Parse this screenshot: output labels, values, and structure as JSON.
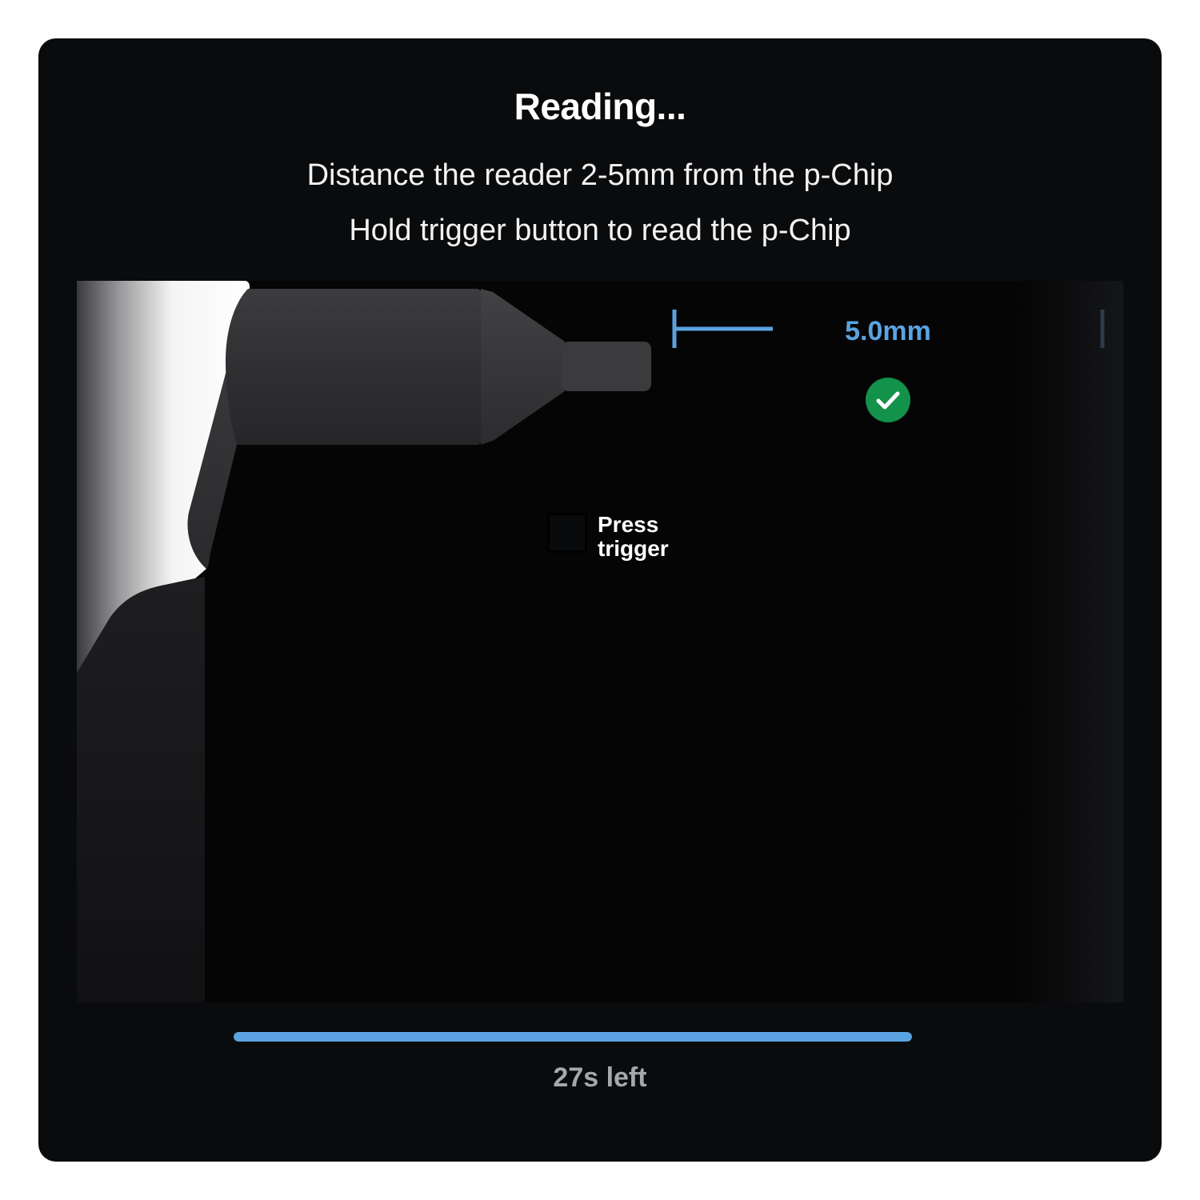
{
  "dialog": {
    "title": "Reading...",
    "instructions": [
      "Distance the reader 2-5mm from the p-Chip",
      "Hold trigger button to read the p-Chip"
    ]
  },
  "illustration": {
    "distance_label": "5.0mm",
    "distance_status_icon": "check-circle-icon",
    "trigger_hint": "Press trigger"
  },
  "progress": {
    "fraction": 1.0,
    "time_left": "27s left"
  },
  "colors": {
    "accent": "#5ba3e0",
    "success": "#12924a",
    "background": "#0a0b0d"
  }
}
